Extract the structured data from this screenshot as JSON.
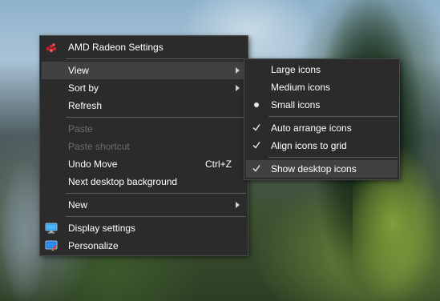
{
  "main_menu": {
    "amd": "AMD Radeon Settings",
    "view": "View",
    "sort_by": "Sort by",
    "refresh": "Refresh",
    "paste": "Paste",
    "paste_shortcut": "Paste shortcut",
    "undo_move": "Undo Move",
    "undo_shortcut": "Ctrl+Z",
    "next_bg": "Next desktop background",
    "new": "New",
    "display_settings": "Display settings",
    "personalize": "Personalize"
  },
  "view_submenu": {
    "large": "Large icons",
    "medium": "Medium icons",
    "small": "Small icons",
    "auto_arrange": "Auto arrange icons",
    "align_grid": "Align icons to grid",
    "show_desktop": "Show desktop icons"
  },
  "colors": {
    "menu_bg": "#2b2b2b",
    "hover_bg": "#414141",
    "disabled_text": "#6d6d6d",
    "amd_red": "#d81e2a"
  },
  "icons": [
    "amd-radeon-icon",
    "chevron-right-icon",
    "display-settings-icon",
    "personalize-icon",
    "checkmark-icon",
    "radio-bullet-icon"
  ]
}
